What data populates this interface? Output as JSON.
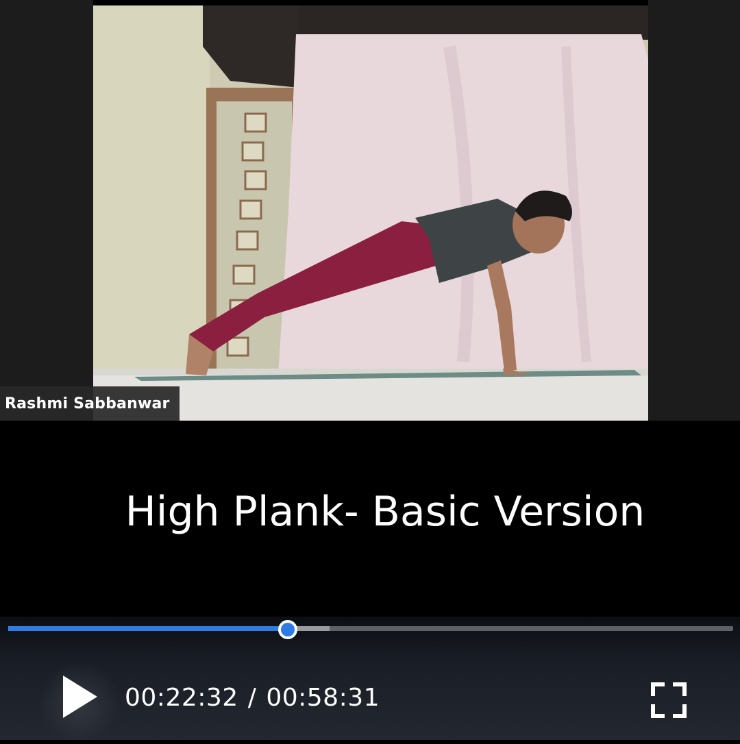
{
  "video": {
    "participant_name": "Rashmi Sabbanwar",
    "caption": "High Plank- Basic Version"
  },
  "player": {
    "current_time": "00:22:32",
    "separator": "/",
    "total_time": "00:58:31",
    "progress_fraction": 0.385,
    "buffered_fraction": 0.443,
    "accent_color": "#2f7be6",
    "icons": {
      "play": "play-icon",
      "fullscreen": "fullscreen-icon"
    }
  }
}
